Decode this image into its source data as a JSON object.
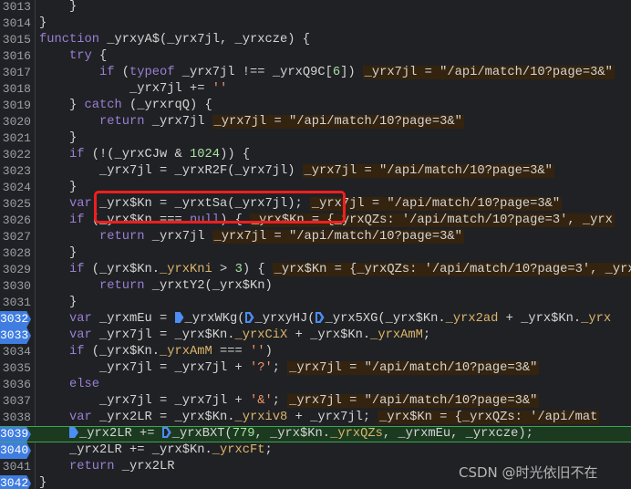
{
  "editor": {
    "active_line": 3039,
    "breakpoint_lines": [
      3032,
      3033,
      3039,
      3040,
      3042
    ],
    "colors": {
      "keyword": "#9a7fd5",
      "number": "#a6e3a1",
      "string": "#f29766",
      "property": "#dcb56a",
      "breakpoint": "#4c8df6",
      "active_line": "#3ca552",
      "highlight_box": "#f01e1e"
    },
    "lines": [
      {
        "num": "3013",
        "indent": 2,
        "tokens": [
          [
            "p",
            "}"
          ]
        ]
      },
      {
        "num": "3014",
        "indent": 1,
        "tokens": [
          [
            "p",
            "}"
          ]
        ]
      },
      {
        "num": "3015",
        "indent": 1,
        "tokens": [
          [
            "k",
            "function"
          ],
          [
            "p",
            " _yrxyA$(_yrx7jl, _yrxcze) {"
          ]
        ]
      },
      {
        "num": "3016",
        "indent": 2,
        "tokens": [
          [
            "k",
            "try"
          ],
          [
            "p",
            " {"
          ]
        ]
      },
      {
        "num": "3017",
        "indent": 3,
        "tokens": [
          [
            "k",
            "if"
          ],
          [
            "p",
            " ("
          ],
          [
            "k",
            "typeof"
          ],
          [
            "p",
            " _yrx7jl !== _yrxQ9C["
          ],
          [
            "n",
            "6"
          ],
          [
            "p",
            "])"
          ]
        ],
        "inline": "_yrx7jl = \"/api/match/10?page=3&\""
      },
      {
        "num": "3018",
        "indent": 4,
        "tokens": [
          [
            "p",
            "_yrx7jl += "
          ],
          [
            "s",
            "''"
          ]
        ]
      },
      {
        "num": "3019",
        "indent": 2,
        "tokens": [
          [
            "p",
            "} "
          ],
          [
            "k",
            "catch"
          ],
          [
            "p",
            " (_yrxrqQ) {"
          ]
        ]
      },
      {
        "num": "3020",
        "indent": 3,
        "tokens": [
          [
            "k",
            "return"
          ],
          [
            "p",
            " _yrx7jl"
          ]
        ],
        "inline": "_yrx7jl = \"/api/match/10?page=3&\""
      },
      {
        "num": "3021",
        "indent": 2,
        "tokens": [
          [
            "p",
            "}"
          ]
        ]
      },
      {
        "num": "3022",
        "indent": 2,
        "tokens": [
          [
            "k",
            "if"
          ],
          [
            "p",
            " (!(_yrxCJw & "
          ],
          [
            "n",
            "1024"
          ],
          [
            "p",
            ")) {"
          ]
        ]
      },
      {
        "num": "3023",
        "indent": 3,
        "tokens": [
          [
            "p",
            "_yrx7jl = _yrxR2F(_yrx7jl)"
          ]
        ],
        "inline": "_yrx7jl = \"/api/match/10?page=3&\""
      },
      {
        "num": "3024",
        "indent": 2,
        "tokens": [
          [
            "p",
            "}"
          ]
        ]
      },
      {
        "num": "3025",
        "indent": 2,
        "tokens": [
          [
            "k",
            "var"
          ],
          [
            "p",
            " _yrx$Kn = _yrxtSa(_yrx7jl);"
          ]
        ],
        "inline": "_yrx7jl = \"/api/match/10?page=3&\""
      },
      {
        "num": "3026",
        "indent": 2,
        "tokens": [
          [
            "k",
            "if"
          ],
          [
            "p",
            " (_yrx$Kn === "
          ],
          [
            "k",
            "null"
          ],
          [
            "p",
            ") {"
          ]
        ],
        "inline": "_yrx$Kn = {_yrxQZs: '/api/match/10?page=3', _yrx"
      },
      {
        "num": "3027",
        "indent": 3,
        "tokens": [
          [
            "k",
            "return"
          ],
          [
            "p",
            " _yrx7jl"
          ]
        ],
        "inline": "_yrx7jl = \"/api/match/10?page=3&\""
      },
      {
        "num": "3028",
        "indent": 2,
        "tokens": [
          [
            "p",
            "}"
          ]
        ]
      },
      {
        "num": "3029",
        "indent": 2,
        "tokens": [
          [
            "k",
            "if"
          ],
          [
            "p",
            " (_yrx$Kn."
          ],
          [
            "pr",
            "_yrxKni"
          ],
          [
            "p",
            " > "
          ],
          [
            "n",
            "3"
          ],
          [
            "p",
            ") {"
          ]
        ],
        "inline": "_yrx$Kn = {_yrxQZs: '/api/match/10?page=3', _yrx"
      },
      {
        "num": "3030",
        "indent": 3,
        "tokens": [
          [
            "k",
            "return"
          ],
          [
            "p",
            " _yrxtY2(_yrx$Kn)"
          ]
        ]
      },
      {
        "num": "3031",
        "indent": 2,
        "tokens": [
          [
            "p",
            "}"
          ]
        ]
      },
      {
        "num": "3032",
        "indent": 2,
        "tokens": [
          [
            "k",
            "var"
          ],
          [
            "p",
            " _yrxmEu = "
          ],
          [
            "bf",
            ""
          ],
          [
            "p",
            "_yrxWKg("
          ],
          [
            "bo",
            ""
          ],
          [
            "p",
            "_yrxyHJ("
          ],
          [
            "bo",
            ""
          ],
          [
            "p",
            "_yrx5XG(_yrx$Kn."
          ],
          [
            "pr",
            "_yrx2ad"
          ],
          [
            "p",
            " + _yrx$Kn."
          ],
          [
            "pr",
            "_yrx"
          ]
        ]
      },
      {
        "num": "3033",
        "indent": 2,
        "tokens": [
          [
            "k",
            "var"
          ],
          [
            "p",
            " _yrx7jl = _yrx$Kn."
          ],
          [
            "pr",
            "_yrxCiX"
          ],
          [
            "p",
            " + _yrx$Kn."
          ],
          [
            "pr",
            "_yrxAmM"
          ],
          [
            "p",
            ";"
          ]
        ]
      },
      {
        "num": "3034",
        "indent": 2,
        "tokens": [
          [
            "k",
            "if"
          ],
          [
            "p",
            " (_yrx$Kn."
          ],
          [
            "pr",
            "_yrxAmM"
          ],
          [
            "p",
            " === "
          ],
          [
            "s",
            "''"
          ],
          [
            "p",
            ")"
          ]
        ]
      },
      {
        "num": "3035",
        "indent": 3,
        "tokens": [
          [
            "p",
            "_yrx7jl = _yrx7jl + "
          ],
          [
            "s",
            "'?'"
          ],
          [
            "p",
            ";"
          ]
        ],
        "inline": "_yrx7jl = \"/api/match/10?page=3&\""
      },
      {
        "num": "3036",
        "indent": 2,
        "tokens": [
          [
            "k",
            "else"
          ]
        ]
      },
      {
        "num": "3037",
        "indent": 3,
        "tokens": [
          [
            "p",
            "_yrx7jl = _yrx7jl + "
          ],
          [
            "s",
            "'&'"
          ],
          [
            "p",
            ";"
          ]
        ],
        "inline": "_yrx7jl = \"/api/match/10?page=3&\""
      },
      {
        "num": "3038",
        "indent": 2,
        "tokens": [
          [
            "k",
            "var"
          ],
          [
            "p",
            " _yrx2LR = _yrx$Kn."
          ],
          [
            "pr",
            "_yrxiv8"
          ],
          [
            "p",
            " + _yrx7jl;"
          ]
        ],
        "inline": "_yrx$Kn = {_yrxQZs: '/api/mat"
      },
      {
        "num": "3039",
        "indent": 2,
        "tokens": [
          [
            "bf",
            ""
          ],
          [
            "p",
            "_yrx2LR += "
          ],
          [
            "bo",
            ""
          ],
          [
            "p",
            "_yrxBXT("
          ],
          [
            "n",
            "779"
          ],
          [
            "p",
            ", _yrx$Kn."
          ],
          [
            "pr",
            "_yrxQZs"
          ],
          [
            "p",
            ", _yrxmEu, _yrxcze);"
          ]
        ]
      },
      {
        "num": "3040",
        "indent": 2,
        "tokens": [
          [
            "p",
            "_yrx2LR += _yrx$Kn."
          ],
          [
            "pr",
            "_yrxcFt"
          ],
          [
            "p",
            ";"
          ]
        ]
      },
      {
        "num": "3041",
        "indent": 2,
        "tokens": [
          [
            "k",
            "return"
          ],
          [
            "p",
            " _yrx2LR"
          ]
        ]
      },
      {
        "num": "3042",
        "indent": 1,
        "tokens": [
          [
            "p",
            "}"
          ]
        ]
      }
    ]
  },
  "watermark": "CSDN @时光依旧不在"
}
